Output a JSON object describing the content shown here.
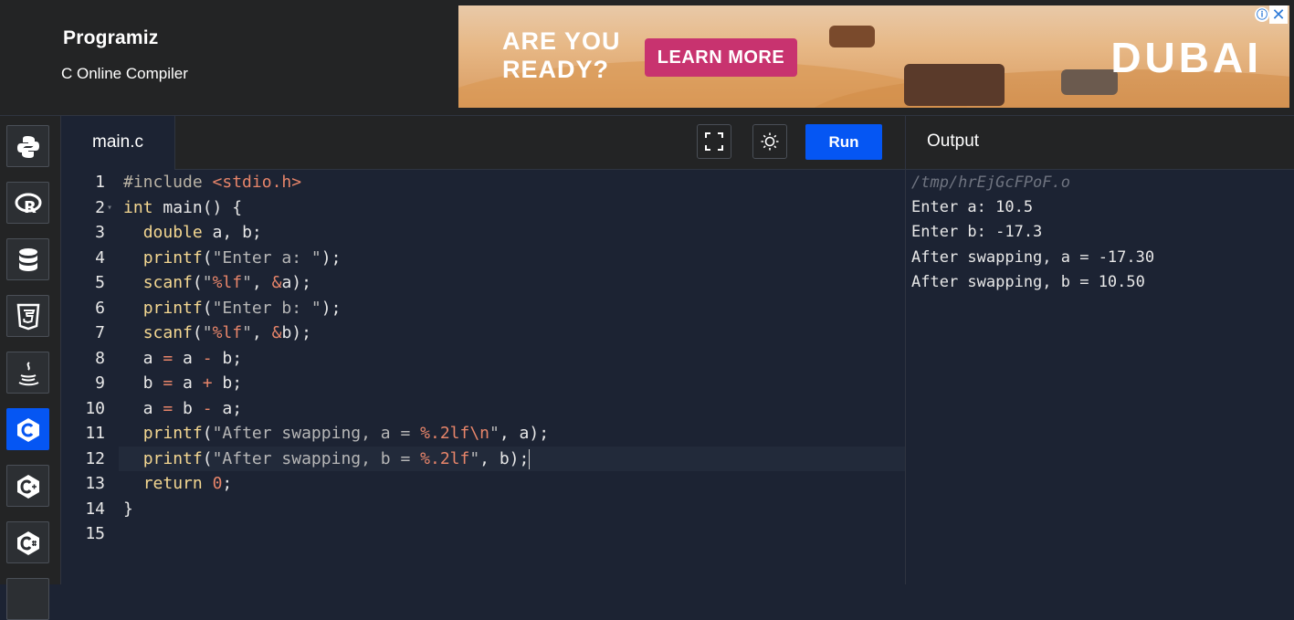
{
  "header": {
    "logo": "Programiz",
    "subtitle": "C Online Compiler"
  },
  "ad": {
    "headline_1": "ARE YOU",
    "headline_2": "READY?",
    "cta": "LEARN MORE",
    "brand": "DUBAI",
    "info_icon": "ⓘ",
    "close_icon": "✕"
  },
  "sidebar": {
    "items": [
      {
        "name": "python",
        "icon": "python-icon"
      },
      {
        "name": "r",
        "icon": "r-icon"
      },
      {
        "name": "sql",
        "icon": "database-icon"
      },
      {
        "name": "html",
        "icon": "html5-icon"
      },
      {
        "name": "java",
        "icon": "java-icon"
      },
      {
        "name": "c",
        "icon": "c-icon",
        "active": true
      },
      {
        "name": "cpp",
        "icon": "cpp-icon"
      },
      {
        "name": "csharp",
        "icon": "csharp-icon"
      }
    ]
  },
  "editor": {
    "tab_label": "main.c",
    "run_label": "Run",
    "fullscreen_icon": "fullscreen-icon",
    "theme_icon": "sun-icon",
    "lines": [
      "1",
      "2",
      "3",
      "4",
      "5",
      "6",
      "7",
      "8",
      "9",
      "10",
      "11",
      "12",
      "13",
      "14",
      "15"
    ],
    "code": [
      "#include <stdio.h>",
      "int main() {",
      "  double a, b;",
      "  printf(\"Enter a: \");",
      "  scanf(\"%lf\", &a);",
      "  printf(\"Enter b: \");",
      "  scanf(\"%lf\", &b);",
      "  a = a - b;",
      "  b = a + b;",
      "  a = b - a;",
      "  printf(\"After swapping, a = %.2lf\\n\", a);",
      "  printf(\"After swapping, b = %.2lf\", b);",
      "  return 0;",
      "}",
      ""
    ]
  },
  "output": {
    "title": "Output",
    "lines": [
      "/tmp/hrEjGcFPoF.o",
      "Enter a: 10.5",
      "Enter b: -17.3",
      "After swapping, a = -17.30",
      "After swapping, b = 10.50"
    ]
  }
}
